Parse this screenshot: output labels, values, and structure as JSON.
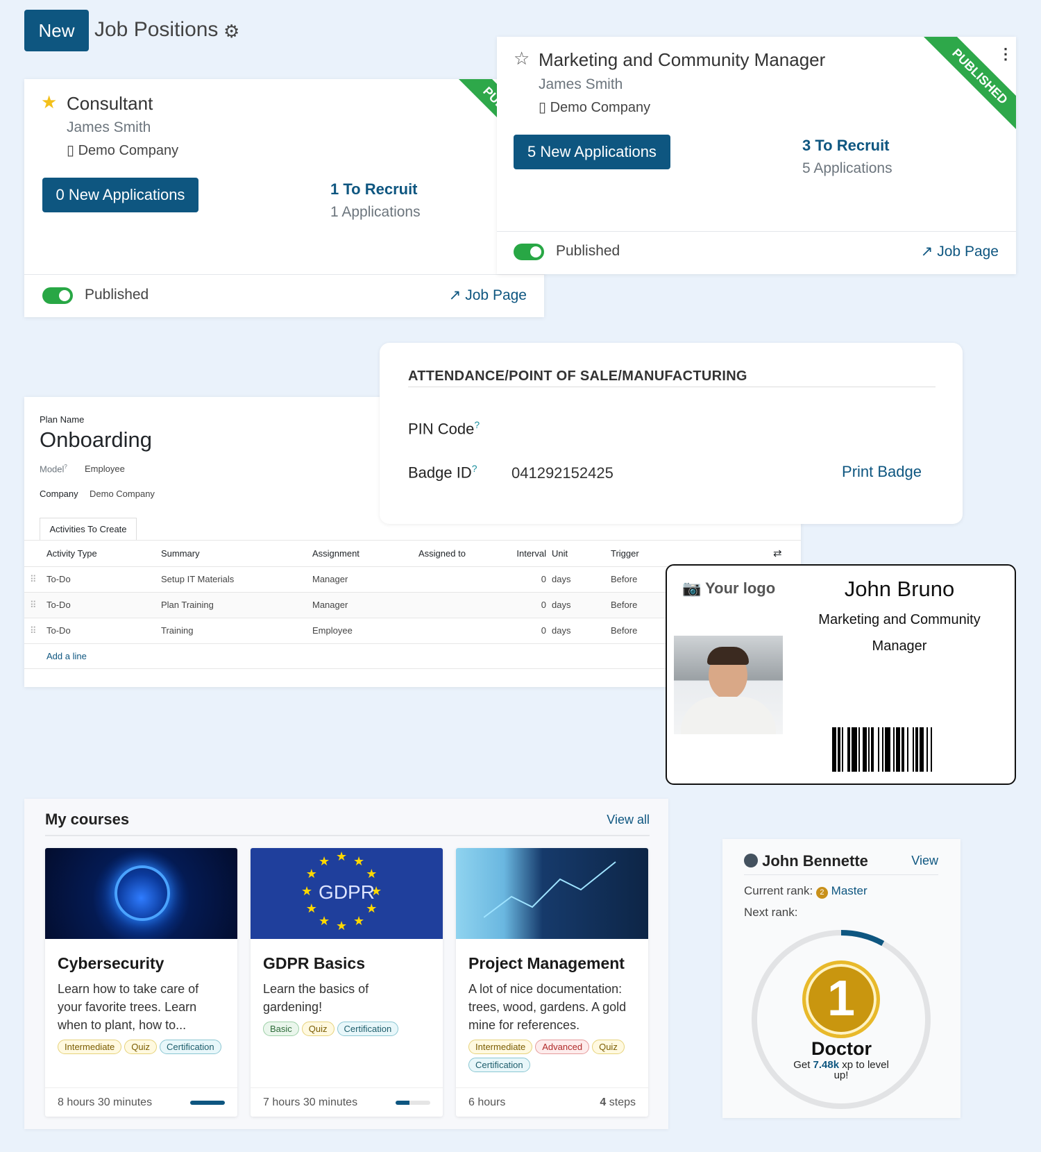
{
  "header": {
    "new_label": "New",
    "title": "Job Positions"
  },
  "jobs": [
    {
      "title": "Consultant",
      "favorite": true,
      "recruiter": "James Smith",
      "company": "Demo Company",
      "new_applications": "0 New Applications",
      "to_recruit": "1 To Recruit",
      "applications": "1 Applications",
      "published_label": "Published",
      "published": true,
      "job_page": "Job Page",
      "ribbon": "PUBLISHED"
    },
    {
      "title": "Marketing and Community Manager",
      "favorite": false,
      "recruiter": "James Smith",
      "company": "Demo Company",
      "new_applications": "5 New Applications",
      "to_recruit": "3 To Recruit",
      "applications": "5 Applications",
      "published_label": "Published",
      "published": true,
      "job_page": "Job Page",
      "ribbon": "PUBLISHED"
    }
  ],
  "attendance": {
    "heading": "ATTENDANCE/POINT OF SALE/MANUFACTURING",
    "pin_label": "PIN Code",
    "help": "?",
    "badge_label": "Badge ID",
    "badge_value": "041292152425",
    "print_badge": "Print Badge"
  },
  "plan": {
    "name_label": "Plan Name",
    "name": "Onboarding",
    "model_label": "Model",
    "model_help": "?",
    "model": "Employee",
    "company_label": "Company",
    "company": "Demo Company",
    "tab": "Activities To Create",
    "columns": [
      "Activity Type",
      "Summary",
      "Assignment",
      "Assigned to",
      "Interval",
      "Unit",
      "Trigger"
    ],
    "rows": [
      [
        "To-Do",
        "Setup IT Materials",
        "Manager",
        "",
        "0",
        "days",
        "Before"
      ],
      [
        "To-Do",
        "Plan Training",
        "Manager",
        "",
        "0",
        "days",
        "Before"
      ],
      [
        "To-Do",
        "Training",
        "Employee",
        "",
        "0",
        "days",
        "Before"
      ]
    ],
    "add_line": "Add a line"
  },
  "badge": {
    "logo": "Your logo",
    "name": "John Bruno",
    "job_line1": "Marketing and Community",
    "job_line2": "Manager"
  },
  "courses": {
    "title": "My courses",
    "view_all": "View all",
    "items": [
      {
        "title": "Cybersecurity",
        "desc": "Learn how to take care of your favorite trees. Learn when to plant, how to...",
        "tags": [
          [
            "Intermediate",
            "t-int"
          ],
          [
            "Quiz",
            "t-quiz"
          ],
          [
            "Certification",
            "t-cert"
          ]
        ],
        "duration": "8 hours 30 minutes",
        "progress": 100
      },
      {
        "title": "GDPR Basics",
        "desc": "Learn the basics of gardening!",
        "image_text": "GDPR",
        "tags": [
          [
            "Basic",
            "t-basic"
          ],
          [
            "Quiz",
            "t-quiz"
          ],
          [
            "Certification",
            "t-cert"
          ]
        ],
        "duration": "7 hours 30 minutes",
        "progress": 40
      },
      {
        "title": "Project Management",
        "desc": "A lot of nice documentation: trees, wood, gardens. A gold mine for references.",
        "tags": [
          [
            "Intermediate",
            "t-int"
          ],
          [
            "Advanced",
            "t-adv"
          ],
          [
            "Quiz",
            "t-quiz"
          ],
          [
            "Certification",
            "t-cert"
          ]
        ],
        "duration": "6 hours",
        "steps_count": "4",
        "steps_label": "steps"
      }
    ]
  },
  "rank": {
    "user": "John Bennette",
    "view": "View",
    "current_label": "Current rank:",
    "current_badge": "2",
    "current": "Master",
    "next_label": "Next rank:",
    "medal": "1",
    "next": "Doctor",
    "get": "Get",
    "xp": "7.48k",
    "rest": "xp to level up!",
    "progress": 8
  },
  "colors": {
    "primary": "#0e5680",
    "published": "#2ea84a",
    "background": "#eaf2fb"
  }
}
